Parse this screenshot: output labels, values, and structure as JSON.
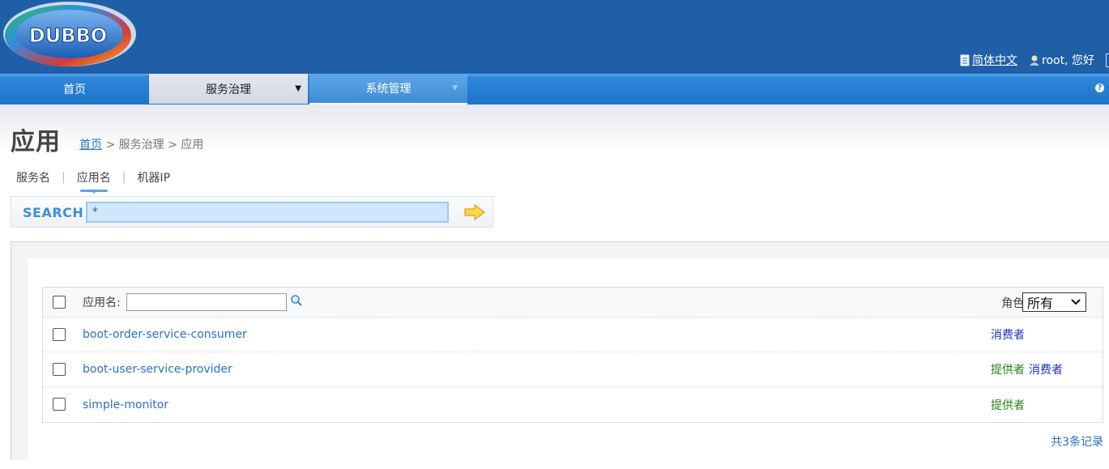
{
  "header": {
    "logo_text": "DUBBO",
    "language_link": "简体中文",
    "user_greeting": "root, 您好"
  },
  "nav": {
    "items": [
      {
        "label": "首页"
      },
      {
        "label": "服务治理",
        "caret": "▼"
      },
      {
        "label": "系统管理",
        "caret": "▼"
      }
    ],
    "help_icon": "?"
  },
  "page": {
    "title": "应用",
    "breadcrumb": {
      "home": "首页",
      "rest": " > 服务治理 > 应用"
    }
  },
  "subtabs": {
    "items": [
      "服务名",
      "应用名",
      "机器IP"
    ],
    "separator": "|",
    "active": "应用名"
  },
  "search": {
    "label": "SEARCH",
    "value": "*"
  },
  "table": {
    "header": {
      "app_filter_label": "应用名:",
      "app_filter_value": "",
      "role_label": "角色:",
      "role_selected": "所有"
    },
    "rows": [
      {
        "app": "boot-order-service-consumer",
        "roles": [
          {
            "text": "消费者",
            "type": "consumer"
          }
        ]
      },
      {
        "app": "boot-user-service-provider",
        "roles": [
          {
            "text": "提供者",
            "type": "provider"
          },
          {
            "text": "消费者",
            "type": "consumer"
          }
        ]
      },
      {
        "app": "simple-monitor",
        "roles": [
          {
            "text": "提供者",
            "type": "provider"
          }
        ]
      }
    ]
  },
  "footer": {
    "total": "共3条记录"
  },
  "colors": {
    "header": "#1f5fa8",
    "link": "#2a6fc9",
    "consumer": "#1b2fbf",
    "provider": "#2a7d18"
  }
}
